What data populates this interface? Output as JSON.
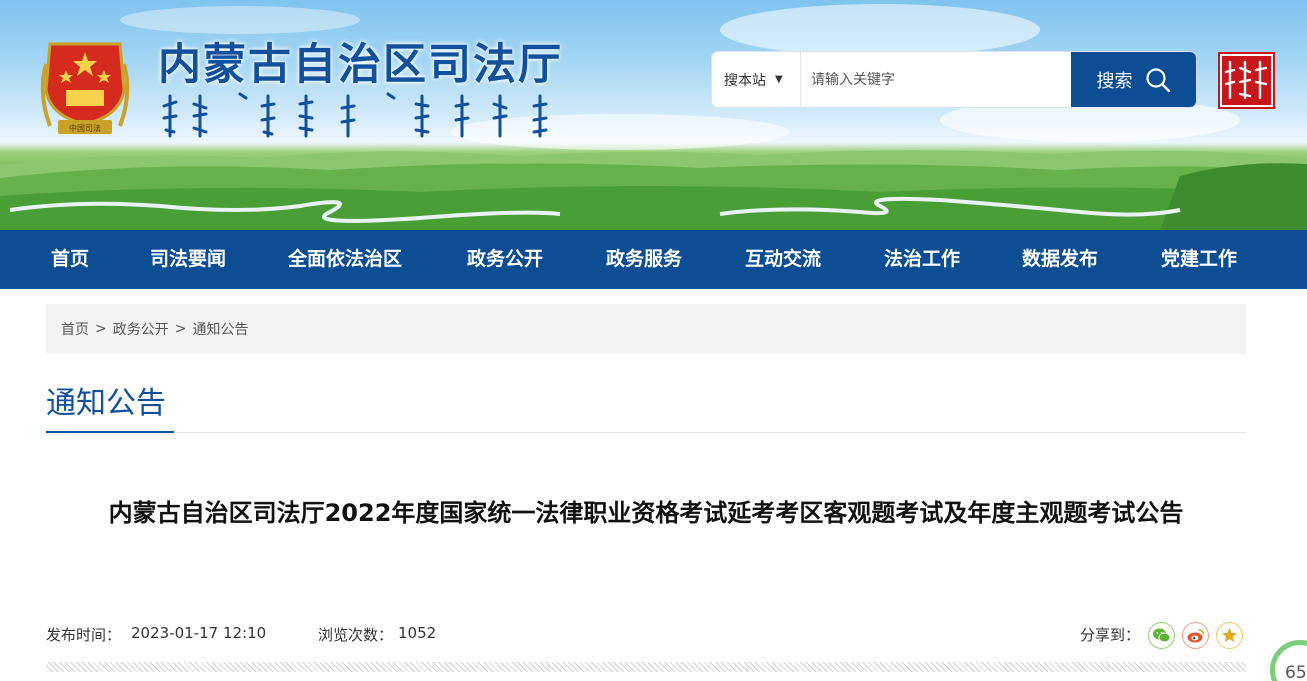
{
  "header": {
    "site_title": "内蒙古自治区司法厅",
    "emblem_caption": "中国司法",
    "seal_text": "内蒙古",
    "search": {
      "scope_label": "搜本站",
      "placeholder": "请输入关键字",
      "button_label": "搜索"
    }
  },
  "nav": {
    "items": [
      {
        "label": "首页"
      },
      {
        "label": "司法要闻"
      },
      {
        "label": "全面依法治区"
      },
      {
        "label": "政务公开"
      },
      {
        "label": "政务服务"
      },
      {
        "label": "互动交流"
      },
      {
        "label": "法治工作"
      },
      {
        "label": "数据发布"
      },
      {
        "label": "党建工作"
      }
    ]
  },
  "breadcrumb": {
    "items": [
      "首页",
      "政务公开",
      "通知公告"
    ],
    "separator": ">"
  },
  "section": {
    "title": "通知公告"
  },
  "article": {
    "title": "内蒙古自治区司法厅2022年度国家统一法律职业资格考试延考考区客观题考试及年度主观题考试公告",
    "publish_label": "发布时间：",
    "publish_time": "2023-01-17 12:10",
    "views_label": "浏览次数：",
    "views": "1052",
    "share_label": "分享到："
  },
  "float_badge": {
    "text": "65"
  },
  "colors": {
    "brand_blue": "#0c4d94",
    "title_blue": "#124f9c",
    "breadcrumb_bg": "#f3f3f3",
    "wechat_green": "#5bb530",
    "weibo_red": "#e6502a",
    "favorite_gold": "#e3a81b"
  },
  "icons": [
    "emblem-icon",
    "chevron-down-icon",
    "search-icon",
    "wechat-icon",
    "weibo-icon",
    "star-icon"
  ]
}
